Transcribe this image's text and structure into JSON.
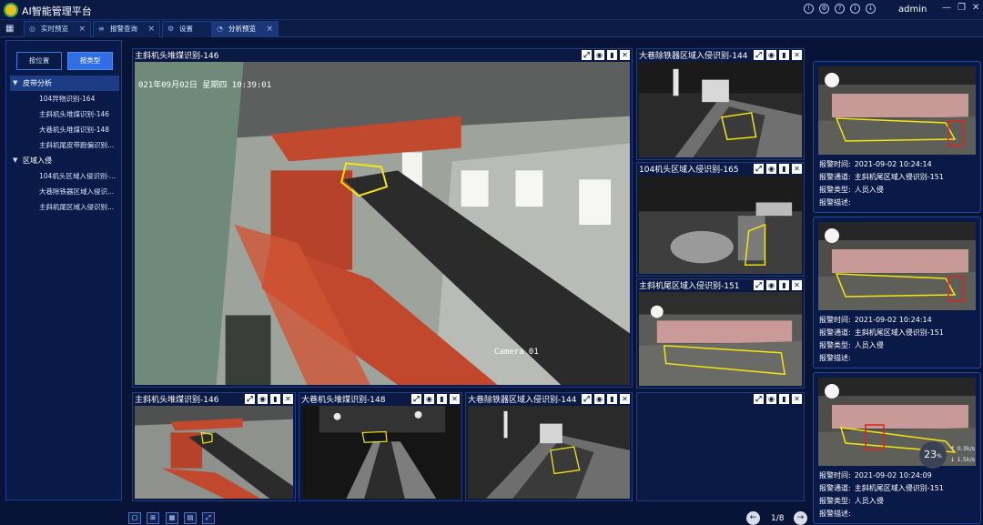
{
  "app": {
    "title": "AI智能管理平台",
    "user": "admin",
    "title_icons": [
      "alarm-icon",
      "settings-icon",
      "help-icon",
      "info-icon",
      "download-icon"
    ]
  },
  "tabs": [
    {
      "label": "实时预览",
      "active": false
    },
    {
      "label": "报警查询",
      "active": false
    },
    {
      "label": "设置",
      "active": false
    },
    {
      "label": "分析预览",
      "active": true
    }
  ],
  "left_panel": {
    "by_position": "按位置",
    "by_type": "按类型",
    "tree": [
      {
        "label": "皮带分析",
        "items": [
          "104异物识别-164",
          "主斜机头堆煤识别-146",
          "大巷机头堆煤识别-148",
          "主斜机尾皮带跑偏识别..."
        ]
      },
      {
        "label": "区域入侵",
        "items": [
          "104机头区域入侵识别-...",
          "大巷除铁器区域入侵识...",
          "主斜机尾区域入侵识别..."
        ]
      }
    ]
  },
  "videos": {
    "main": {
      "title": "主斜机头堆煤识别-146",
      "osd_time": "021年09月02日  星期四   10:39:01",
      "osd_cam": "Camera 01"
    },
    "side1": {
      "title": "大巷除铁器区域入侵识别-144"
    },
    "side2": {
      "title": "104机头区域入侵识别-165"
    },
    "side3": {
      "title": "主斜机尾区域入侵识别-151"
    },
    "bottom1": {
      "title": "主斜机头堆煤识别-146"
    },
    "bottom2": {
      "title": "大巷机头堆煤识别-148"
    },
    "bottom3": {
      "title": "大巷除铁器区域入侵识别-144"
    },
    "bottom4": {
      "title": ""
    }
  },
  "alarm_labels": {
    "time": "报警时间:",
    "channel": "报警通道:",
    "type": "报警类型:",
    "desc": "报警描述:"
  },
  "alarms": [
    {
      "time": "2021-09-02 10:24:14",
      "channel": "主斜机尾区域入侵识别-151",
      "type": "人员入侵",
      "desc": ""
    },
    {
      "time": "2021-09-02 10:24:14",
      "channel": "主斜机尾区域入侵识别-151",
      "type": "人员入侵",
      "desc": ""
    },
    {
      "time": "2021-09-02 10:24:09",
      "channel": "主斜机尾区域入侵识别-151",
      "type": "人员入侵",
      "desc": ""
    }
  ],
  "net": {
    "badge": "23",
    "badge_unit": "%",
    "up": "0.3k/s",
    "down": "1.5k/s"
  },
  "pager": {
    "text": "1/8"
  },
  "colors": {
    "accent": "#2f6fe3",
    "bg": "#071437",
    "panel_border": "#1d3e86",
    "detect_box": "#f3e60f",
    "person_box": "#e0231b"
  }
}
